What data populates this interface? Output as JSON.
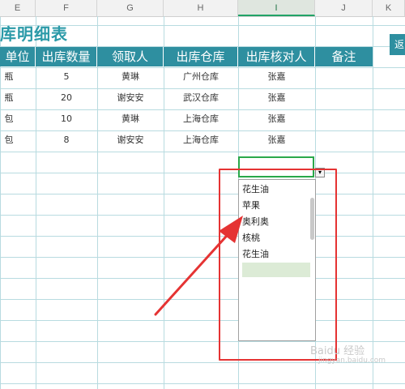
{
  "columns": [
    {
      "letter": "E"
    },
    {
      "letter": "F"
    },
    {
      "letter": "G"
    },
    {
      "letter": "H"
    },
    {
      "letter": "I"
    },
    {
      "letter": "J"
    },
    {
      "letter": "K"
    }
  ],
  "title": "库明细表",
  "headers": [
    "单位",
    "出库数量",
    "领取人",
    "出库仓库",
    "出库核对人",
    "备注"
  ],
  "rows": [
    {
      "unit": "瓶",
      "qty": "5",
      "receiver": "黄琳",
      "warehouse": "广州仓库",
      "checker": "张嘉"
    },
    {
      "unit": "瓶",
      "qty": "20",
      "receiver": "谢安安",
      "warehouse": "武汉仓库",
      "checker": "张嘉"
    },
    {
      "unit": "包",
      "qty": "10",
      "receiver": "黄琳",
      "warehouse": "上海仓库",
      "checker": "张嘉"
    },
    {
      "unit": "包",
      "qty": "8",
      "receiver": "谢安安",
      "warehouse": "上海仓库",
      "checker": "张嘉"
    }
  ],
  "right_button": {
    "label": "返"
  },
  "dropdown": {
    "items": [
      "花生油",
      "苹果",
      "奥利奥",
      "核桃",
      "花生油",
      ""
    ],
    "selected_index": 5,
    "arrow": "▾"
  },
  "annotation_color": "#e53333",
  "watermark": {
    "text": "Baidu 经验",
    "subtext": "jingyan.baidu.com"
  }
}
